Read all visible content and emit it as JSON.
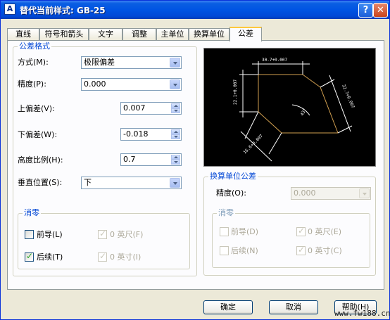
{
  "window": {
    "title": "替代当前样式: GB-25",
    "icon_letter": "A",
    "help_btn": "?",
    "close_btn": "✕"
  },
  "tabs": [
    "直线",
    "符号和箭头",
    "文字",
    "调整",
    "主单位",
    "换算单位",
    "公差"
  ],
  "active_tab": "公差",
  "tolerance_format": {
    "title": "公差格式",
    "method_label": "方式(M):",
    "method_value": "极限偏差",
    "precision_label": "精度(P):",
    "precision_value": "0.000",
    "upper_label": "上偏差(V):",
    "upper_value": "0.007",
    "lower_label": "下偏差(W):",
    "lower_value": "-0.018",
    "height_label": "高度比例(H):",
    "height_value": "0.7",
    "vertical_label": "垂直位置(S):",
    "vertical_value": "下"
  },
  "zero_suppression": {
    "title": "消零",
    "leading_label": "前导(L)",
    "leading_checked": false,
    "trailing_label": "后续(T)",
    "trailing_checked": true,
    "feet_label": "0 英尺(F)",
    "feet_checked": true,
    "inches_label": "0 英寸(I)",
    "inches_checked": true
  },
  "alt_units": {
    "title": "换算单位公差",
    "precision_label": "精度(O):",
    "precision_value": "0.000",
    "zero_title": "消零",
    "leading_label": "前导(D)",
    "leading_checked": false,
    "trailing_label": "后续(N)",
    "trailing_checked": false,
    "feet_label": "0 英尺(E)",
    "feet_checked": true,
    "inches_label": "0 英寸(C)",
    "inches_checked": true
  },
  "buttons": {
    "ok": "确定",
    "cancel": "取消",
    "help": "帮助(H)"
  },
  "watermark": "www.fw188.cn",
  "colors": {
    "titlebar": "#0054e3",
    "group_title": "#0046d5",
    "preview_bg": "#000000",
    "preview_line_dim": "#ffffff",
    "preview_line_shape": "#d2a050"
  }
}
